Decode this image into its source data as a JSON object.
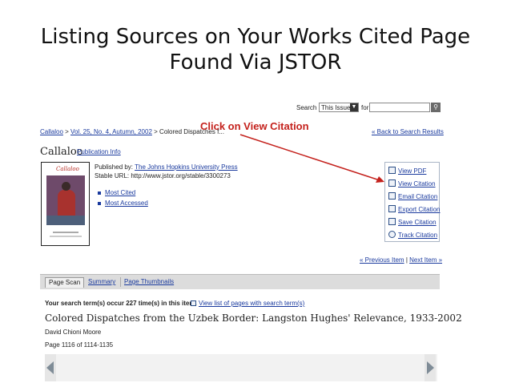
{
  "slide": {
    "title_line1": "Listing Sources on Your Works Cited Page",
    "title_line2": "Found Via JSTOR"
  },
  "search": {
    "label": "Search",
    "scope": "This Issue",
    "for_label": "for"
  },
  "breadcrumb": {
    "items": [
      "Callaloo",
      "Vol. 25, No. 4, Autumn, 2002",
      "Colored Dispatches f..."
    ],
    "separator": ">",
    "back_link": "« Back to Search Results"
  },
  "callout": {
    "text": "Click on View Citation",
    "color": "#c4211c"
  },
  "journal": {
    "title": "Callaloo",
    "info_link": "Publication Info",
    "published_by_label": "Published by:",
    "publisher": "The Johns Hopkins University Press",
    "stable_url": "Stable URL: http://www.jstor.org/stable/3300273",
    "cover_logo": "Callaloo",
    "links": [
      "Most Cited",
      "Most Accessed"
    ]
  },
  "actions": {
    "items": [
      {
        "label": "View PDF",
        "icon": "pdf-icon"
      },
      {
        "label": "View Citation",
        "icon": "citation-icon"
      },
      {
        "label": "Email Citation",
        "icon": "email-icon"
      },
      {
        "label": "Export Citation",
        "icon": "export-icon"
      },
      {
        "label": "Save Citation",
        "icon": "save-icon"
      },
      {
        "label": "Track Citation",
        "icon": "track-icon"
      }
    ]
  },
  "pager": {
    "previous": "« Previous Item",
    "divider": "|",
    "next": "Next Item »"
  },
  "tabs": [
    "Page Scan",
    "Summary",
    "Page Thumbnails"
  ],
  "results": {
    "search_terms_note": "Your search term(s) occur 227 time(s) in this item.",
    "list_pages_link": "View list of pages with search term(s)"
  },
  "document": {
    "title": "Colored Dispatches from the Uzbek Border: Langston Hughes' Relevance, 1933-2002",
    "author": "David Chioni Moore",
    "page_info": "Page 1116 of 1114-1135"
  },
  "colors": {
    "link": "#1a3a9e",
    "accent": "#c4211c"
  }
}
